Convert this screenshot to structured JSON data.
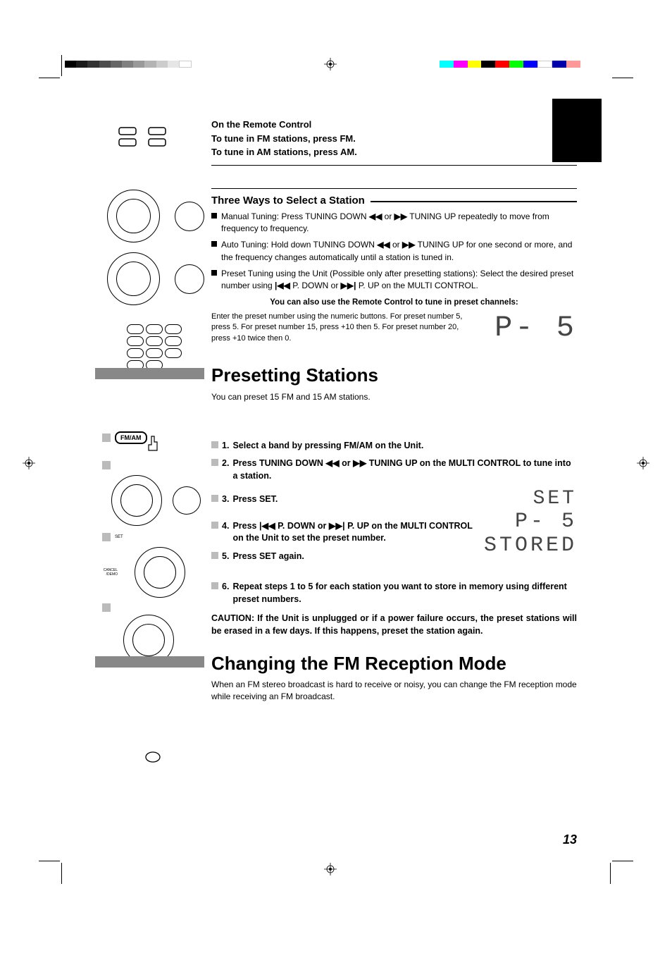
{
  "page_number": "13",
  "intro": {
    "line1": "On the Remote Control",
    "line2": "To tune in FM stations, press FM.",
    "line3": "To tune in AM stations, press AM."
  },
  "three_ways": {
    "heading": "Three Ways to Select a Station",
    "item1_a": "Manual Tuning: Press TUNING DOWN ",
    "item1_b": " or ",
    "item1_c": " TUNING UP repeatedly to move from frequency to frequency.",
    "item2_a": "Auto Tuning: Hold down TUNING DOWN ",
    "item2_b": " or ",
    "item2_c": " TUNING UP for one second or more, and the frequency changes automatically until a station is tuned in.",
    "item3_a": "Preset Tuning using the Unit (Possible only after presetting stations): Select the desired preset number using ",
    "item3_b": " P. DOWN or ",
    "item3_c": " P. UP on the MULTI CONTROL.",
    "note": "You can also use the Remote Control to tune in preset channels:",
    "remote_desc_a": "Enter the preset number using the numeric buttons. For preset number 5, press 5. For preset number 15, press +10 then 5. For preset number 20, press +10 twice then 0.",
    "display_example": "P- 5"
  },
  "presetting": {
    "heading": "Presetting Stations",
    "intro": "You can preset 15 FM and 15 AM stations.",
    "s1": "Select a band by pressing FM/AM on the Unit.",
    "s2_a": "Press TUNING DOWN ",
    "s2_b": " or ",
    "s2_c": " TUNING UP on the MULTI CONTROL to tune into a station.",
    "s3": "Press SET.",
    "s4_a": "Press ",
    "s4_b": " P. DOWN or ",
    "s4_c": " P. UP on the MULTI CONTROL on the Unit to set the preset number.",
    "s5": "Press SET again.",
    "s6": "Repeat steps 1 to 5 for each station you want to store in memory using different preset numbers.",
    "caution": "CAUTION: If the Unit is unplugged or if a power failure occurs, the preset stations will be erased in a few days. If this happens, preset the station again.",
    "disp_set": "SET",
    "disp_p5": "P- 5",
    "disp_stored": "STORED"
  },
  "fm_mode": {
    "heading": "Changing the FM Reception Mode",
    "body": "When an FM stereo broadcast is hard to receive or noisy, you can change the FM reception mode while receiving an FM broadcast."
  },
  "labels": {
    "fmam": "FM/AM",
    "rew": "◀◀",
    "ff": "▶▶",
    "prev": "|◀◀",
    "next": "▶▶|",
    "n1": "1.",
    "n2": "2.",
    "n3": "3.",
    "n4": "4.",
    "n5": "5.",
    "n6": "6."
  }
}
